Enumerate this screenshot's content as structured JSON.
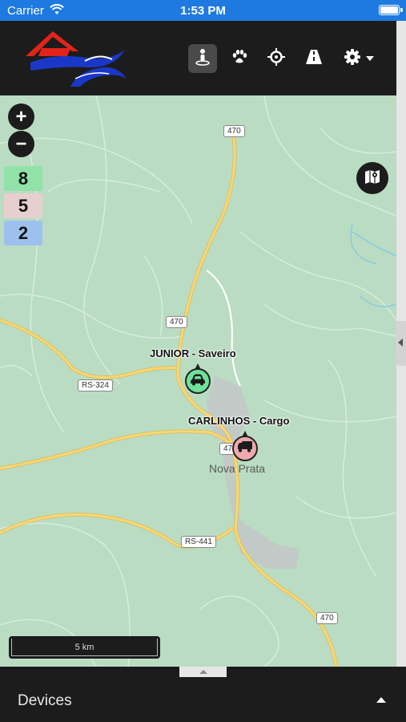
{
  "status_bar": {
    "carrier": "Carrier",
    "time": "1:53 PM"
  },
  "header": {
    "logo_icon": "company-logo",
    "toolbar": [
      {
        "icon": "person-location-icon",
        "active": true
      },
      {
        "icon": "paw-icon",
        "active": false
      },
      {
        "icon": "crosshair-icon",
        "active": false
      },
      {
        "icon": "road-icon",
        "active": false
      },
      {
        "icon": "gear-icon",
        "active": false
      }
    ]
  },
  "map": {
    "zoom_in": "+",
    "zoom_out": "−",
    "counters": [
      {
        "value": "8",
        "color": "#90e2a8"
      },
      {
        "value": "5",
        "color": "#e6cfcf"
      },
      {
        "value": "2",
        "color": "#9dc1ee"
      }
    ],
    "road_shields": [
      "470",
      "470",
      "RS-324",
      "470",
      "RS-441",
      "470"
    ],
    "place": "Nova Prata",
    "vehicles": [
      {
        "label": "JUNIOR - Saveiro",
        "icon": "car-icon",
        "color": "#6fe29a"
      },
      {
        "label": "CARLINHOS - Cargo",
        "icon": "truck-icon",
        "color": "#f1a8b1"
      }
    ],
    "scale": "5 km"
  },
  "bottom_panel": {
    "title": "Devices"
  },
  "colors": {
    "status_bar": "#1e7ae0",
    "header_bg": "#1c1c1c",
    "map_bg": "#b9dcc2",
    "road_major": "#f6d778"
  }
}
